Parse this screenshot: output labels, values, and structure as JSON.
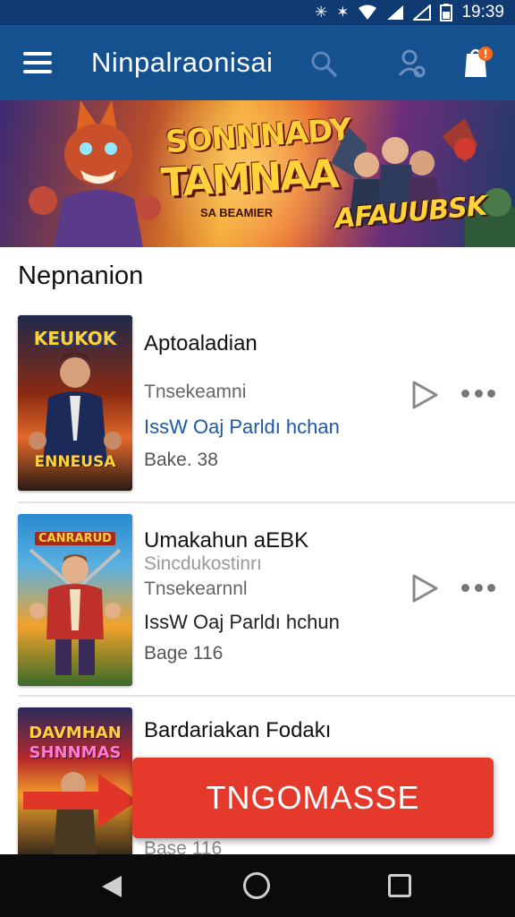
{
  "status_bar": {
    "time": "19:39",
    "icons": [
      "nfc-icon",
      "bluetooth-icon",
      "wifi-icon",
      "signal-icon",
      "signal-icon",
      "battery-icon"
    ]
  },
  "app_bar": {
    "title": "Ninpalraonisai",
    "icons": [
      "menu-icon",
      "search-icon",
      "account-icon",
      "notification-icon"
    ],
    "notification_badge_color": "#ff6a1a",
    "background": "#15508f"
  },
  "banner": {
    "title_line1": "SONNNADY",
    "title_line2": "TAMNAA",
    "subtitle": "SA BEAMIER",
    "tag": "AFAUUBSK"
  },
  "section": {
    "title": "Nepnanion"
  },
  "items": [
    {
      "poster_label_top": "KEUKOK",
      "poster_label_bottom": "ENNEUSA",
      "title": "Aptoaladian",
      "subtitle": "Tnsekeamni",
      "link": "IssW Oaj Parldı hchan",
      "meta": "Bake. 38"
    },
    {
      "poster_label_top": "CANRARUD",
      "poster_label_bottom": "",
      "title": "Umakahun aEBK",
      "subtitle_extra": "Sincdukostinrı",
      "subtitle": "Tnsekearnnl",
      "link": "IssW Oaj Parldı hchun",
      "meta": "Bage 116"
    },
    {
      "poster_label_top": "DAVMHAN",
      "poster_label_bottom": "SHNNMAS",
      "title": "Bardariakan Fodakı",
      "subtitle": "",
      "link": "",
      "meta": "Base 116"
    }
  ],
  "cta": {
    "label": "TNGOMASSE",
    "color": "#e53a2b"
  },
  "nav_bar": {
    "icons": [
      "back-icon",
      "home-icon",
      "recents-icon"
    ]
  }
}
